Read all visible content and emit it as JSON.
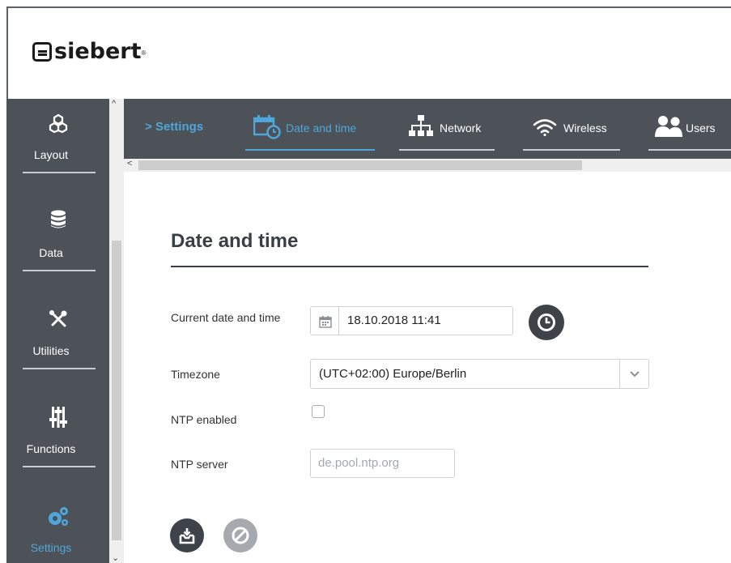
{
  "brand": {
    "logo_text": "siebert",
    "registered": "®"
  },
  "sidebar": {
    "items": [
      {
        "label": "Layout",
        "icon": "layout-icon",
        "active": false
      },
      {
        "label": "Data",
        "icon": "database-icon",
        "active": false
      },
      {
        "label": "Utilities",
        "icon": "tools-icon",
        "active": false
      },
      {
        "label": "Functions",
        "icon": "sliders-icon",
        "active": false
      },
      {
        "label": "Settings",
        "icon": "gears-icon",
        "active": true
      }
    ]
  },
  "breadcrumb": {
    "label": "Settings"
  },
  "tabs": [
    {
      "label": "Date and time",
      "icon": "calendar-clock-icon",
      "active": true
    },
    {
      "label": "Network",
      "icon": "network-icon",
      "active": false
    },
    {
      "label": "Wireless",
      "icon": "wifi-icon",
      "active": false
    },
    {
      "label": "Users",
      "icon": "users-icon",
      "active": false
    }
  ],
  "page": {
    "title": "Date and time"
  },
  "form": {
    "datetime_label": "Current date and time",
    "datetime_value": "18.10.2018 11:41",
    "timezone_label": "Timezone",
    "timezone_value": "(UTC+02:00) Europe/Berlin",
    "ntp_enabled_label": "NTP enabled",
    "ntp_enabled": false,
    "ntp_server_label": "NTP server",
    "ntp_server_placeholder": "de.pool.ntp.org"
  },
  "colors": {
    "accent": "#4fa6d8",
    "sidebar_bg": "#4d5259",
    "heading": "#3a3f45"
  }
}
